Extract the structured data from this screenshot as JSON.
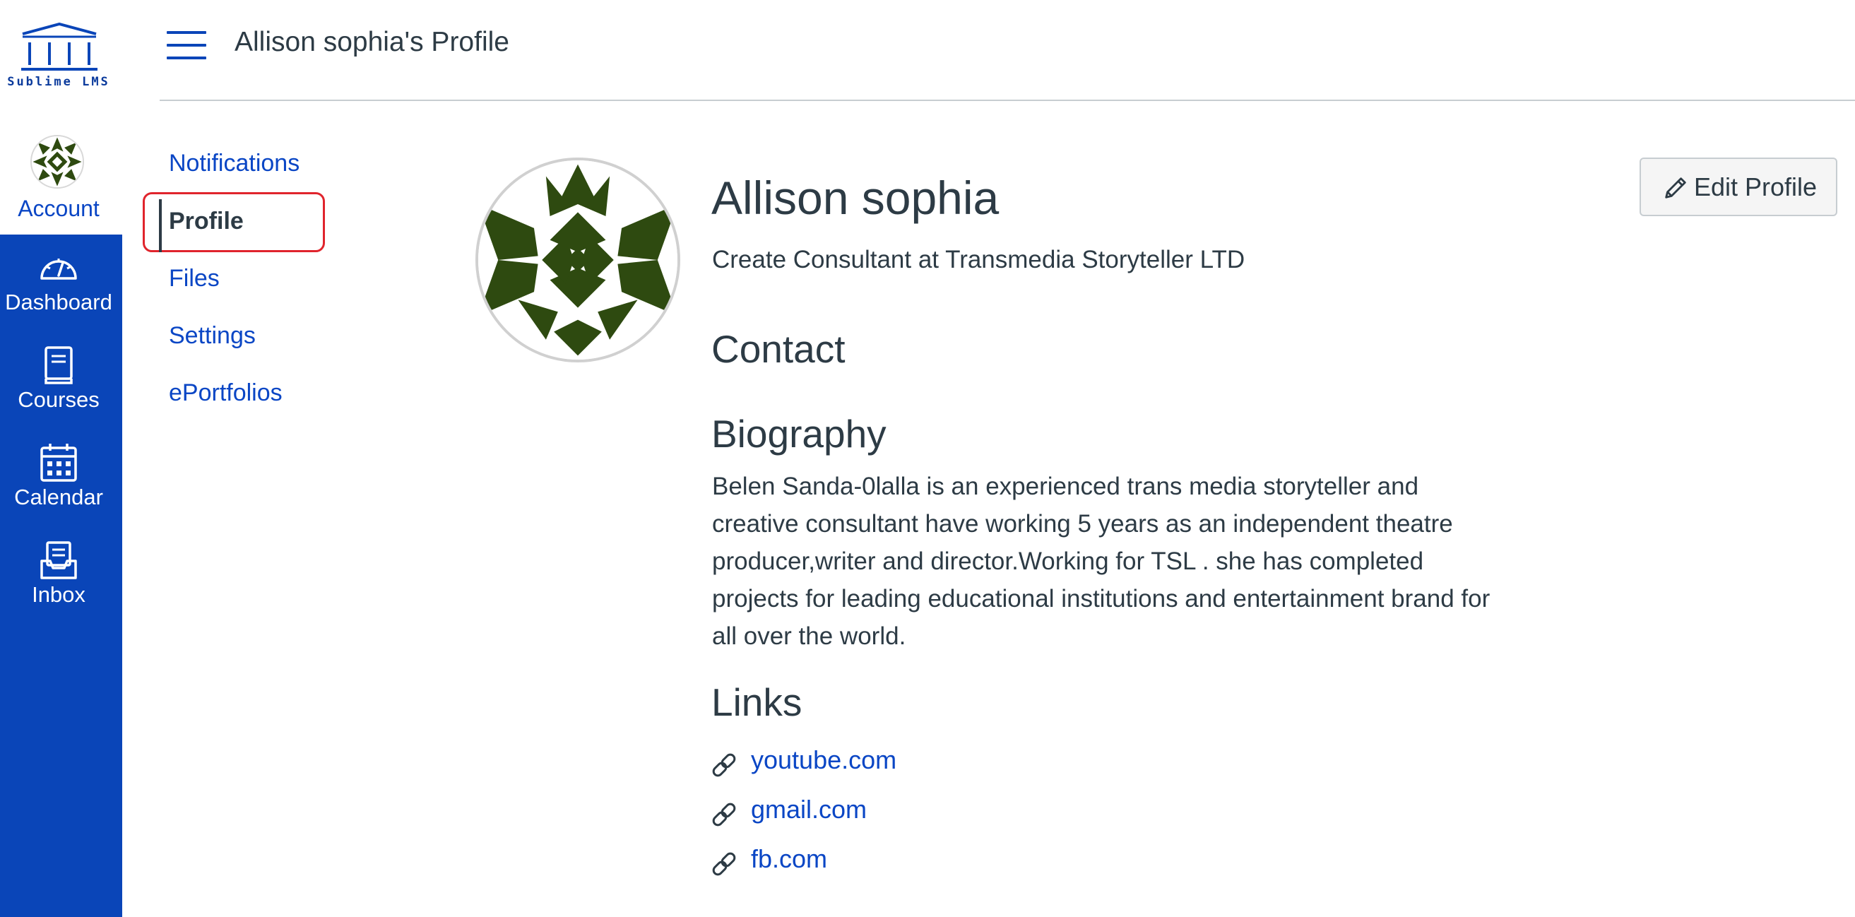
{
  "brand": {
    "name": "Sublime LMS"
  },
  "global_nav": {
    "account_label": "Account",
    "items": [
      {
        "label": "Dashboard",
        "icon": "dashboard-icon"
      },
      {
        "label": "Courses",
        "icon": "book-icon"
      },
      {
        "label": "Calendar",
        "icon": "calendar-icon"
      },
      {
        "label": "Inbox",
        "icon": "inbox-icon"
      }
    ]
  },
  "header": {
    "title": "Allison sophia's Profile"
  },
  "sub_nav": {
    "items": [
      {
        "label": "Notifications"
      },
      {
        "label": "Profile",
        "active": true
      },
      {
        "label": "Files"
      },
      {
        "label": "Settings"
      },
      {
        "label": "ePortfolios"
      }
    ]
  },
  "profile": {
    "name": "Allison sophia",
    "title": "Create Consultant at Transmedia Storyteller LTD",
    "contact_heading": "Contact",
    "biography_heading": "Biography",
    "biography": "Belen Sanda-0lalla is an experienced trans media storyteller and creative consultant have working 5 years as an independent theatre producer,writer and director.Working for TSL . she has completed projects for leading educational institutions and entertainment brand for all over the world.",
    "links_heading": "Links",
    "links": [
      "youtube.com",
      "gmail.com",
      "fb.com"
    ],
    "edit_button": "Edit Profile"
  },
  "colors": {
    "nav_blue": "#0a45b8",
    "link_blue": "#0a46c5",
    "text": "#2d3b45",
    "avatar_green": "#2e4a10",
    "highlight_red": "#e0242c"
  }
}
